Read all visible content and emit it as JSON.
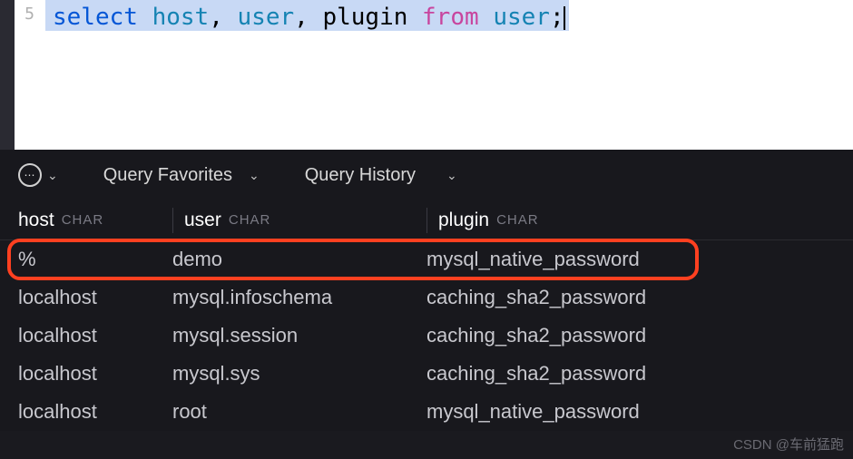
{
  "editor": {
    "line_number": "5",
    "tokens": {
      "select": "select",
      "host": "host",
      "comma1": ", ",
      "user": "user",
      "comma2": ", ",
      "plugin": "plugin",
      "space1": " ",
      "from": "from",
      "space2": " ",
      "user2": "user",
      "semi": ";"
    }
  },
  "toolbar": {
    "favorites_label": "Query Favorites",
    "history_label": "Query History"
  },
  "columns": {
    "host": {
      "name": "host",
      "type": "CHAR"
    },
    "user": {
      "name": "user",
      "type": "CHAR"
    },
    "plugin": {
      "name": "plugin",
      "type": "CHAR"
    }
  },
  "rows": [
    {
      "host": "%",
      "user": "demo",
      "plugin": "mysql_native_password",
      "highlighted": true
    },
    {
      "host": "localhost",
      "user": "mysql.infoschema",
      "plugin": "caching_sha2_password"
    },
    {
      "host": "localhost",
      "user": "mysql.session",
      "plugin": "caching_sha2_password"
    },
    {
      "host": "localhost",
      "user": "mysql.sys",
      "plugin": "caching_sha2_password"
    },
    {
      "host": "localhost",
      "user": "root",
      "plugin": "mysql_native_password"
    }
  ],
  "watermark": "CSDN @车前猛跑",
  "chart_data": {
    "type": "table",
    "title": "select host, user, plugin from user;",
    "columns": [
      "host",
      "user",
      "plugin"
    ],
    "rows": [
      [
        "%",
        "demo",
        "mysql_native_password"
      ],
      [
        "localhost",
        "mysql.infoschema",
        "caching_sha2_password"
      ],
      [
        "localhost",
        "mysql.session",
        "caching_sha2_password"
      ],
      [
        "localhost",
        "mysql.sys",
        "caching_sha2_password"
      ],
      [
        "localhost",
        "root",
        "mysql_native_password"
      ]
    ]
  }
}
